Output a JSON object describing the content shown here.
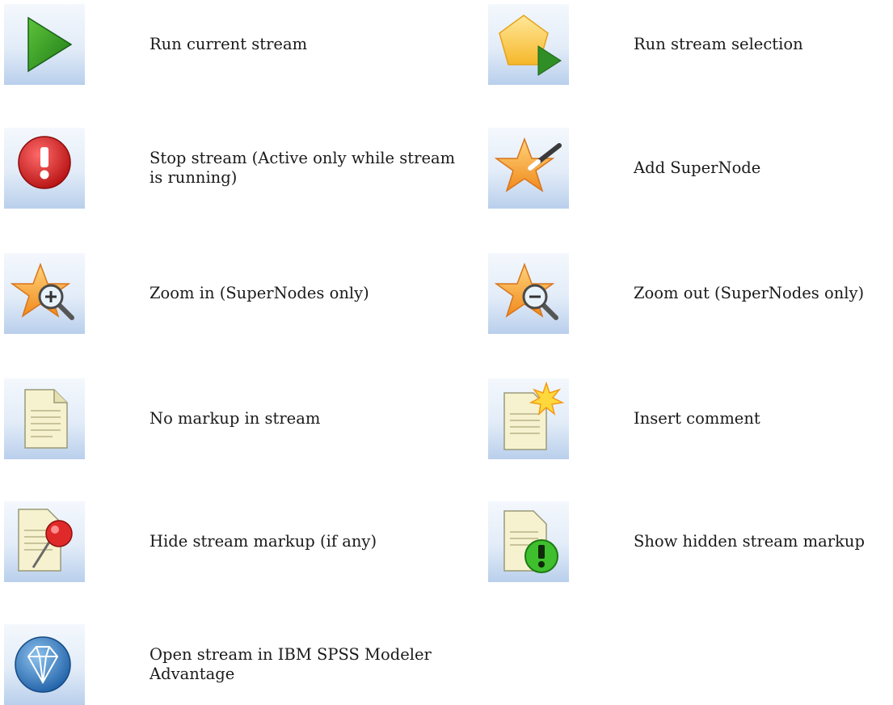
{
  "items": [
    {
      "label": "Run current stream",
      "icon": "run-stream-icon"
    },
    {
      "label": "Run stream selection",
      "icon": "run-selection-icon"
    },
    {
      "label": "Stop stream (Active only while stream is running)",
      "icon": "stop-stream-icon"
    },
    {
      "label": "Add SuperNode",
      "icon": "add-supernode-icon"
    },
    {
      "label": "Zoom in (SuperNodes only)",
      "icon": "zoom-in-icon"
    },
    {
      "label": "Zoom out (SuperNodes only)",
      "icon": "zoom-out-icon"
    },
    {
      "label": "No markup in stream",
      "icon": "no-markup-icon"
    },
    {
      "label": "Insert comment",
      "icon": "insert-comment-icon"
    },
    {
      "label": "Hide stream markup (if any)",
      "icon": "hide-markup-icon"
    },
    {
      "label": "Show hidden stream markup",
      "icon": "show-hidden-markup-icon"
    },
    {
      "label": "Open stream in IBM SPSS Modeler Advantage",
      "icon": "modeler-advantage-icon"
    }
  ]
}
